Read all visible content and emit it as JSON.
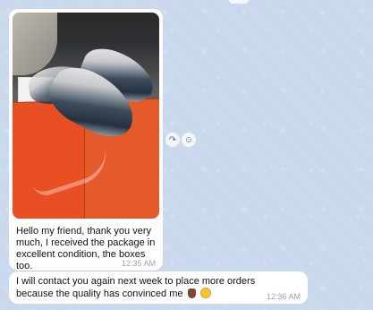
{
  "messages": [
    {
      "caption": "Hello my friend, thank you very much, I received the package in excellent condition, the boxes too.",
      "time": "12:35 AM",
      "image": "photo of sneakers on orange shoe boxes"
    },
    {
      "text": "I will contact you again next week to place more orders because the quality has convinced me",
      "emojis": [
        "ok-hand-emoji",
        "smiling-face-emoji"
      ],
      "time": "12:36 AM"
    }
  ],
  "actions": {
    "forward_icon": "↷",
    "react_icon": "☺"
  },
  "colors": {
    "chat_background": "#c9d8ec",
    "bubble": "#ffffff",
    "timestamp": "#9aa3ad"
  }
}
